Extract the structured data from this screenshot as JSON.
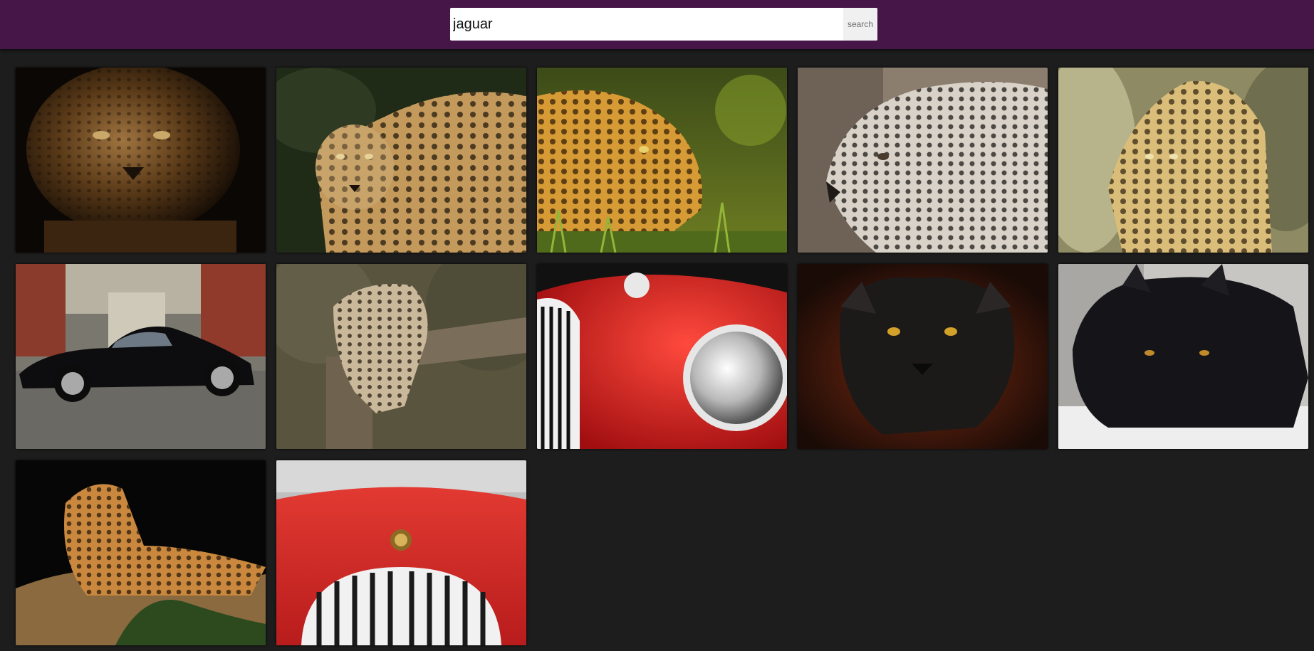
{
  "search": {
    "value": "jaguar",
    "button_label": "search"
  },
  "colors": {
    "header_bg": "#451647",
    "page_bg": "#1d1d1d"
  },
  "results": [
    {
      "subject": "jaguar-face-closeup-icon"
    },
    {
      "subject": "jaguar-standing-forest-icon"
    },
    {
      "subject": "jaguar-profile-grass-icon"
    },
    {
      "subject": "jaguar-profile-sepia-icon"
    },
    {
      "subject": "jaguar-rocks-icon"
    },
    {
      "subject": "black-jaguar-e-type-car-icon"
    },
    {
      "subject": "leopard-on-log-icon"
    },
    {
      "subject": "red-jaguar-car-headlight-icon"
    },
    {
      "subject": "black-panther-face-icon"
    },
    {
      "subject": "black-panther-lying-icon"
    },
    {
      "subject": "jaguar-lying-on-rock-icon"
    },
    {
      "subject": "red-jaguar-car-grille-icon"
    }
  ]
}
